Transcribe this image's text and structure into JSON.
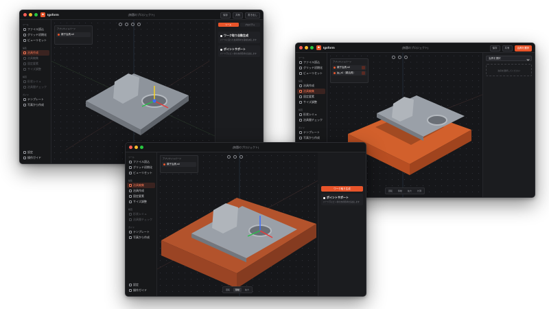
{
  "app": {
    "name": "Igoform",
    "project": "(無題のプロジェクト)"
  },
  "toolbar": {
    "btn1": "保存",
    "btn2": "共有",
    "btn3": "書き出し",
    "btn4": "治具を選択"
  },
  "sidebar": {
    "sec_tools": "ツール",
    "sec_edit": "編集",
    "sec_check": "検査",
    "sec_guide": "ガイド",
    "items": [
      "ファイル読込",
      "グリッド初期化",
      "ビューリセット",
      "治具作成",
      "治具編集",
      "固定要素",
      "サイズ調整",
      "形状シミュ",
      "治具間チェック",
      "テンプレート",
      "写真から作成",
      "設定",
      "操作ガイド"
    ]
  },
  "parts_panel": {
    "title": "アプリケイトパーツ",
    "part1": "親子治具.stl",
    "part2": "jig_a1（親治具）"
  },
  "right_panel": {
    "tab1": "ツール",
    "tab2": "プロパティ",
    "tool1_title": "ワーク取り自動生成",
    "tool1_desc": "パーツに沿った治具形状を自動生成します",
    "tool2_title": "ポイントサポート",
    "tool2_desc": "パーツ下にピン状の支持形状を追加します",
    "generate_btn": "ワーク取り生成",
    "select_label": "治具を選択",
    "empty_hint": "治具を選択してください"
  },
  "bottom": {
    "b1": "回転",
    "b2": "移動",
    "b3": "拡大",
    "b4": "計測"
  },
  "colors": {
    "accent": "#e8542a",
    "jig": "#c4562a",
    "part": "#9aa0a8",
    "bg": "#16171a"
  }
}
